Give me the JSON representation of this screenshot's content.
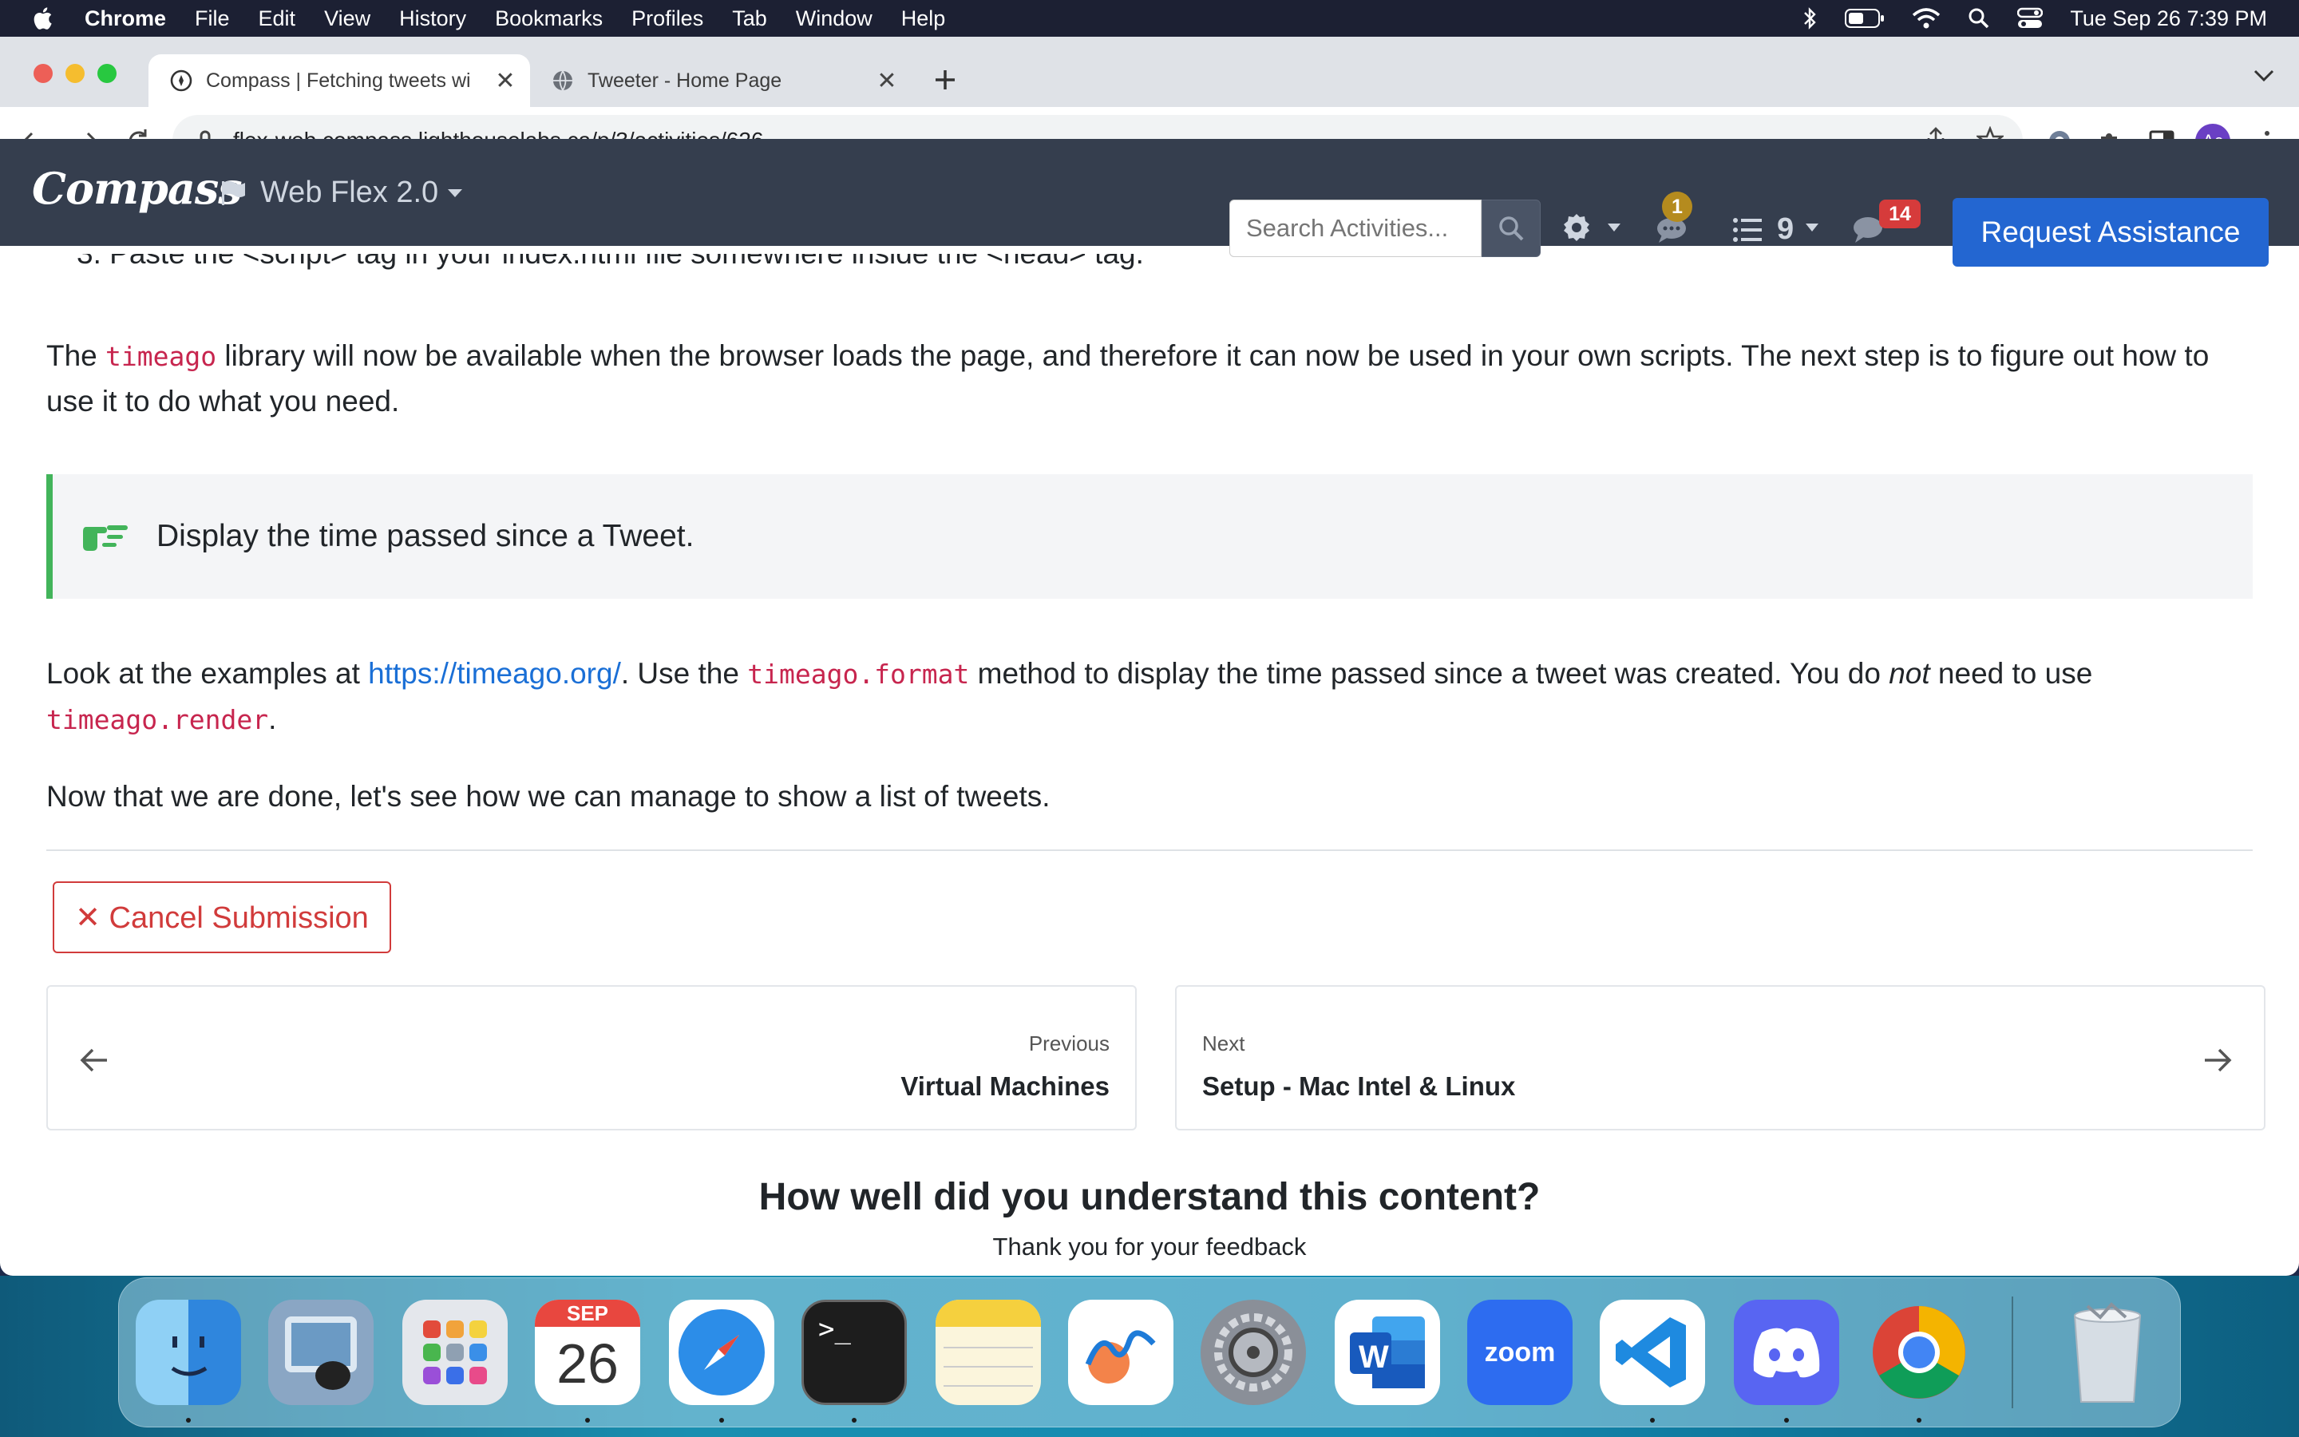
{
  "menubar": {
    "app": "Chrome",
    "items": [
      "File",
      "Edit",
      "View",
      "History",
      "Bookmarks",
      "Profiles",
      "Tab",
      "Window",
      "Help"
    ],
    "clock": "Tue Sep 26  7:39 PM"
  },
  "tabs": [
    {
      "title": "Compass | Fetching tweets wi",
      "active": true
    },
    {
      "title": "Tweeter - Home Page",
      "active": false
    }
  ],
  "omnibox": {
    "url": "flex-web.compass.lighthouselabs.ca/p/3/activities/626"
  },
  "profile": {
    "initials": "Ac"
  },
  "compass": {
    "logo": "Compass",
    "course": "Web Flex 2.0",
    "search_placeholder": "Search Activities...",
    "notifications_count": "1",
    "queue_count": "9",
    "messages_count": "14",
    "request_label": "Request Assistance"
  },
  "content": {
    "partial_step": "3. Paste the <script> tag in your index.html file somewhere inside the <head> tag.",
    "p1_a": "The ",
    "p1_code": "timeago",
    "p1_b": " library will now be available when the browser loads the page, and therefore it can now be used in your own scripts. The next step is to figure out how to use it to do what you need.",
    "callout": "Display the time passed since a Tweet.",
    "p2_a": "Look at the examples at ",
    "p2_link": "https://timeago.org/",
    "p2_b": ". Use the ",
    "p2_code1": "timeago.format",
    "p2_c": " method to display the time passed since a tweet was created. You do ",
    "p2_em": "not",
    "p2_d": " need to use ",
    "p2_code2": "timeago.render",
    "p2_e": ".",
    "p3": "Now that we are done, let's see how we can manage to show a list of tweets."
  },
  "cancel_label": "✕ Cancel Submission",
  "prev": {
    "label": "Previous",
    "title": "Virtual Machines"
  },
  "next": {
    "label": "Next",
    "title": "Setup - Mac Intel & Linux"
  },
  "feedback": {
    "title": "How well did you understand this content?",
    "subtitle": "Thank you for your feedback"
  },
  "dock": {
    "calendar_month": "SEP",
    "calendar_day": "26",
    "zoom_label": "zoom",
    "word_letter": "W"
  }
}
